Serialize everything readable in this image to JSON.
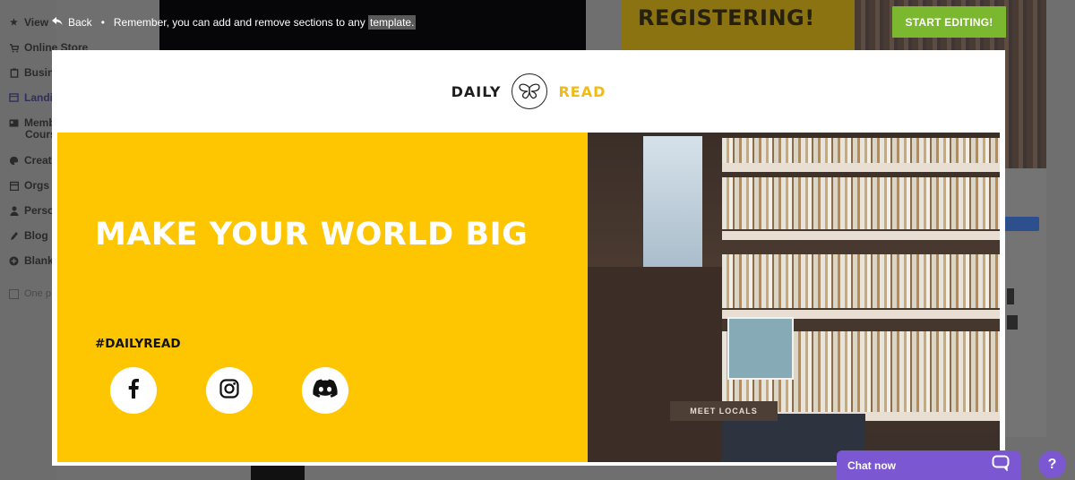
{
  "sidebar": {
    "items": [
      {
        "label": "View",
        "icon": "star-icon"
      },
      {
        "label": "Online Store",
        "icon": "cart-icon"
      },
      {
        "label": "Busin",
        "icon": "clipboard-icon"
      },
      {
        "label": "Landi",
        "icon": "page-icon"
      },
      {
        "label": "Memb",
        "sub": "Cours",
        "icon": "id-card-icon"
      },
      {
        "label": "Creat",
        "icon": "palette-icon"
      },
      {
        "label": "Orgs",
        "icon": "calendar-icon"
      },
      {
        "label": "Perso",
        "icon": "person-icon"
      },
      {
        "label": "Blog",
        "icon": "pen-icon"
      },
      {
        "label": "Blank",
        "icon": "plus-circle-icon"
      },
      {
        "label": "One p",
        "icon": "checkbox-icon"
      }
    ]
  },
  "topbar": {
    "back_label": "Back",
    "bullet": "•",
    "hint_prefix": "Remember, you can add and remove sections to any ",
    "hint_highlight": "template."
  },
  "background": {
    "banner_text": "REGISTERING!"
  },
  "start_editing_label": "START EDITING!",
  "preview": {
    "logo": {
      "left": "DAILY",
      "right": "READ",
      "mark_icon": "butterfly-icon"
    },
    "hero": {
      "title": "MAKE YOUR WORLD BIG",
      "hashtag": "#DAILYREAD",
      "photo_sign": "MEET LOCALS",
      "social": [
        {
          "name": "facebook-icon"
        },
        {
          "name": "instagram-icon"
        },
        {
          "name": "discord-icon"
        }
      ]
    },
    "colors": {
      "accent_yellow": "#fec600",
      "logo_yellow": "#f2bb14"
    }
  },
  "chat": {
    "label": "Chat now"
  },
  "help": {
    "label": "?"
  },
  "colors": {
    "start_button": "#7cb82f",
    "chat_purple": "#7b57d1"
  }
}
